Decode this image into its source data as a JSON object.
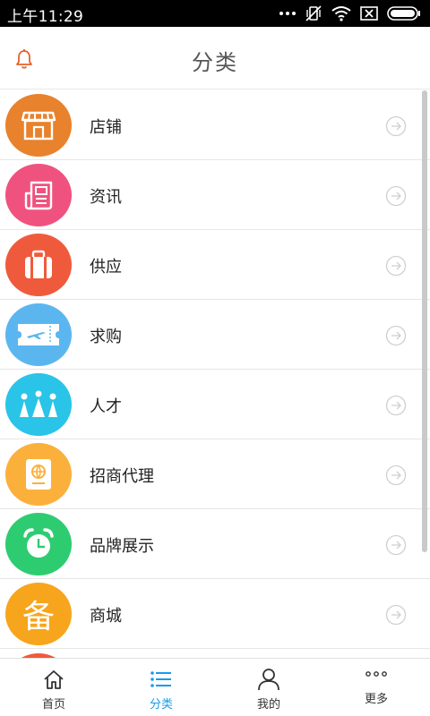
{
  "status_bar": {
    "time": "上午11:29"
  },
  "header": {
    "title": "分类"
  },
  "categories": [
    {
      "label": "店铺",
      "color": "#e9822c",
      "icon": "storefront-icon"
    },
    {
      "label": "资讯",
      "color": "#f0527f",
      "icon": "newspaper-icon"
    },
    {
      "label": "供应",
      "color": "#f05a3c",
      "icon": "luggage-icon"
    },
    {
      "label": "求购",
      "color": "#5bb6f0",
      "icon": "ticket-plane-icon"
    },
    {
      "label": "人才",
      "color": "#29c4e8",
      "icon": "crown-icon"
    },
    {
      "label": "招商代理",
      "color": "#fbb03b",
      "icon": "passport-icon"
    },
    {
      "label": "品牌展示",
      "color": "#2ecc71",
      "icon": "alarm-clock-icon"
    },
    {
      "label": "商城",
      "color": "#f7a51c",
      "icon": "bei-character-icon",
      "icon_text": "备"
    }
  ],
  "bottom_nav": [
    {
      "label": "首页",
      "icon": "home-icon",
      "active": false
    },
    {
      "label": "分类",
      "icon": "list-icon",
      "active": true
    },
    {
      "label": "我的",
      "icon": "user-icon",
      "active": false
    },
    {
      "label": "更多",
      "icon": "more-dots-icon",
      "active": false
    }
  ],
  "colors": {
    "accent": "#1a9be8",
    "bell": "#e8612c"
  }
}
